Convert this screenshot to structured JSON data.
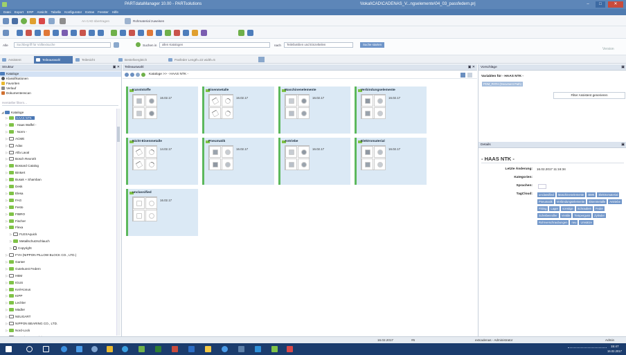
{
  "window": {
    "title": "PARTdataManager 10.00 - PARTsolutions",
    "path": "\\\\lokal\\CAD\\CADENAS_V...ngselemente\\04_03_passfedern.prj",
    "minimize": "–",
    "maximize": "□",
    "close": "✕"
  },
  "menu": [
    "Datei",
    "Export",
    "ERP",
    "Ansicht",
    "Tabelle",
    "Konfigurator",
    "Extras",
    "Fenster",
    "Hilfe"
  ],
  "toolbar2": {
    "cad_transfer": "An CAD übertragen",
    "raw_material": "Rohmaterial zuweisen"
  },
  "search": {
    "all_label": "Alle",
    "term_placeholder": "Suchbegriff für Volltextsuche",
    "search_in": "Suchen in",
    "all_catalogs": "allen Katalogen",
    "after": "nach",
    "families": "Teilefamilien und Einzelteilen",
    "start": "Suche starten",
    "version": "Version"
  },
  "tabs": [
    {
      "label": "Assistent"
    },
    {
      "label": "Teileauswahl"
    },
    {
      "label": "Teilesicht"
    },
    {
      "label": "Bestellvergleich"
    },
    {
      "label": "Pasfeder Length=22 width=5"
    }
  ],
  "left": {
    "header": "Struktur",
    "top_items": [
      "Kataloge",
      "Klassifikationen",
      "Favoriten",
      "Verlauf",
      "Dokumentenscan"
    ],
    "filter_placeholder": "Hersteller filtern...",
    "tree_root": "Kataloge",
    "tree": [
      {
        "label": "HAAS NTK -",
        "sel": true,
        "indent": 1
      },
      {
        "label": "- Haas Waffel -",
        "indent": 1
      },
      {
        "label": "- Norm -",
        "indent": 1
      },
      {
        "label": "ACME",
        "indent": 1,
        "open": true
      },
      {
        "label": "Adax",
        "indent": 1,
        "open": true
      },
      {
        "label": "Alfa Laval",
        "indent": 1,
        "open": true
      },
      {
        "label": "Bosch Rexroth",
        "indent": 1,
        "open": true
      },
      {
        "label": "Bossard Catalog",
        "indent": 1
      },
      {
        "label": "Binkert",
        "indent": 1
      },
      {
        "label": "Busak + Shamban",
        "indent": 1
      },
      {
        "label": "Desk",
        "indent": 1
      },
      {
        "label": "Elesa",
        "indent": 1
      },
      {
        "label": "FAG",
        "indent": 1
      },
      {
        "label": "Festo",
        "indent": 1
      },
      {
        "label": "FIBRO",
        "indent": 1
      },
      {
        "label": "Fischer",
        "indent": 1
      },
      {
        "label": "Flexa",
        "indent": 1
      },
      {
        "label": "FLEXAquick",
        "indent": 2,
        "open": true
      },
      {
        "label": "Metallschutzschlauch",
        "indent": 2
      },
      {
        "label": "Copyright",
        "indent": 2,
        "doc": true
      },
      {
        "label": "FYH (NIPPON PILLOW BLOCK CO., LTD.)",
        "indent": 1,
        "open": true
      },
      {
        "label": "Ganter",
        "indent": 1
      },
      {
        "label": "Gutekunst Federn",
        "indent": 1
      },
      {
        "label": "HBM",
        "indent": 1,
        "open": true
      },
      {
        "label": "IGUS",
        "indent": 1
      },
      {
        "label": "Keil-Konus",
        "indent": 1
      },
      {
        "label": "KIPP",
        "indent": 1
      },
      {
        "label": "Lechler",
        "indent": 1
      },
      {
        "label": "Mädler",
        "indent": 1
      },
      {
        "label": "NEUGART",
        "indent": 1,
        "open": true
      },
      {
        "label": "NIPPON BEARING CO., LTD.",
        "indent": 1,
        "open": true
      },
      {
        "label": "Nord-Lock",
        "indent": 1
      },
      {
        "label": "NSK Linear Precision",
        "indent": 1,
        "open": true
      }
    ]
  },
  "center": {
    "header": "Teileauswahl",
    "breadcrumb": "Kataloge  >>  - HAAS NTK -",
    "cards": [
      {
        "title": "Kunststoffe",
        "date": "16.02.17"
      },
      {
        "title": "Eisenmetalle",
        "date": "16.02.17"
      },
      {
        "title": "Maschinenelemente",
        "date": "16.02.17"
      },
      {
        "title": "Verbindungselemente",
        "date": "16.02.17"
      },
      {
        "title": "Nicht-Eisenmetalle",
        "date": "14.02.17"
      },
      {
        "title": "Pneumatik",
        "date": "16.02.17"
      },
      {
        "title": "Antriebe",
        "date": "16.02.17"
      },
      {
        "title": "Elektromaterial",
        "date": "16.02.17"
      },
      {
        "title": "unclassified",
        "date": "16.02.17"
      }
    ]
  },
  "right": {
    "vorschlaege_header": "Vorschläge",
    "variables_title": "Variablen für - HAAS NTK -",
    "variable_tag": "PDM_PATH (Document Path)",
    "filter_assistant": "Filter Assistent generieren",
    "details_header": "Details",
    "details_title": "- HAAS NTK -",
    "fields": [
      {
        "k": "Letzte Änderung:",
        "v": "16.02.2017 11:16:34"
      },
      {
        "k": "Kategorien:",
        "v": ""
      },
      {
        "k": "Sprachen:",
        "v": ""
      },
      {
        "k": "TagCloud:",
        "v": ""
      }
    ],
    "tags": [
      "unclassified",
      "Maschinenelemente",
      "BMK",
      "Elektromaterial",
      "Pneumatik",
      "Verbindungselemente",
      "Eisenmetalle",
      "Antriebe",
      "Fitting",
      "Lager",
      "sonstige",
      "Schrauben",
      "Feder",
      "Scheibenroller",
      "Ventile",
      "Temperguss",
      "Zylinder",
      "Rohrverschraubungen",
      "neu",
      "Umsätze"
    ]
  },
  "status": {
    "date": "16.02.2017",
    "count": "#6",
    "user": "extcadenas - Administrator",
    "role": "Admin"
  },
  "taskbar": {
    "clock_time": "15:47",
    "clock_date": "16.02.2017"
  }
}
